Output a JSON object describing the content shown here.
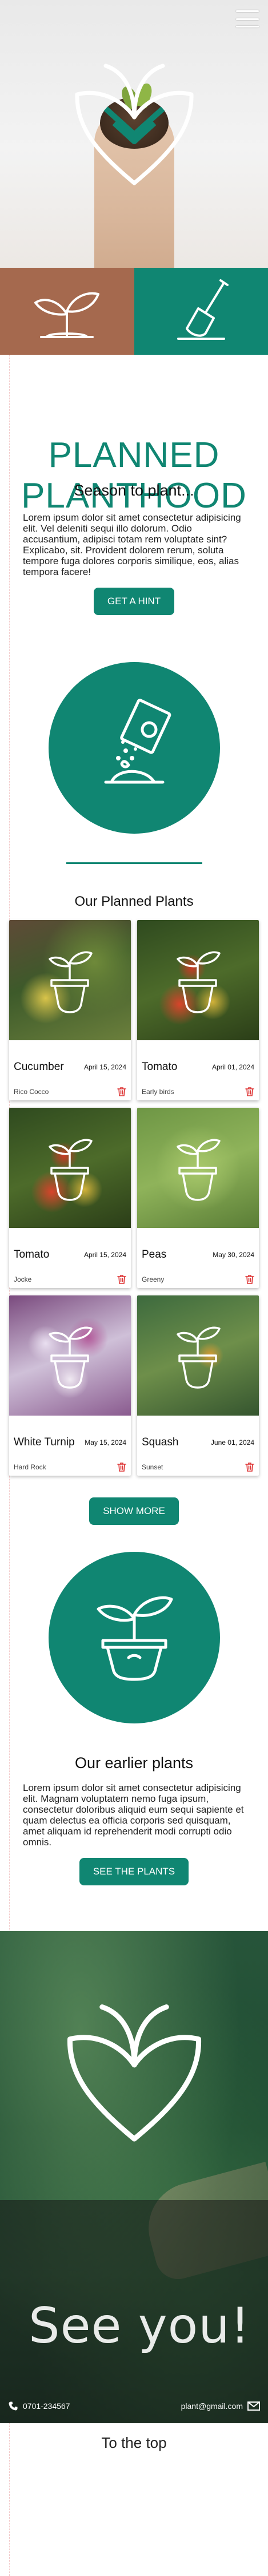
{
  "nav": {
    "menu_icon": "hamburger-menu-icon"
  },
  "hero": {
    "logo_icon": "leaf-heart-logo-icon"
  },
  "tiles": [
    {
      "icon": "sprout-icon",
      "color": "#a5694e"
    },
    {
      "icon": "shovel-icon",
      "color": "#108672"
    }
  ],
  "brand": {
    "title": "PLANNED PLANTHOOD"
  },
  "season": {
    "heading": "Season to plant...",
    "body": "Lorem ipsum dolor sit amet consectetur adipisicing elit. Vel deleniti sequi illo dolorum. Odio accusantium, adipisci totam rem voluptate sint? Explicabo, sit. Provident dolorem rerum, soluta tempore fuga dolores corporis similique, eos, alias tempora facere!",
    "button": "GET A HINT",
    "icon": "seed-packet-icon"
  },
  "planned": {
    "heading": "Our Planned Plants",
    "cards": [
      {
        "name": "Cucumber",
        "date": "April 15, 2024",
        "author": "Rico Cocco",
        "photo": "cucumber-photo"
      },
      {
        "name": "Tomato",
        "date": "April 01, 2024",
        "author": "Early birds",
        "photo": "tomato-photo"
      },
      {
        "name": "Tomato",
        "date": "April 15, 2024",
        "author": "Jocke",
        "photo": "tomato-photo"
      },
      {
        "name": "Peas",
        "date": "May 30, 2024",
        "author": "Greeny",
        "photo": "peas-photo"
      },
      {
        "name": "White Turnip",
        "date": "May 15, 2024",
        "author": "Hard Rock",
        "photo": "turnip-photo"
      },
      {
        "name": "Squash",
        "date": "June 01, 2024",
        "author": "Sunset",
        "photo": "squash-photo"
      }
    ],
    "show_more": "SHOW MORE"
  },
  "earlier": {
    "heading": "Our earlier plants",
    "body": "Lorem ipsum dolor sit amet consectetur adipisicing elit. Magnam voluptatem nemo fuga ipsum, consectetur doloribus aliquid eum sequi sapiente et quam delectus ea officia corporis sed quisquam, amet aliquam id reprehenderit modi corrupti odio omnis.",
    "button": "SEE THE PLANTS",
    "icon": "potted-plant-icon"
  },
  "footer": {
    "see_you": "See you!",
    "phone": "0701-234567",
    "email": "plant@gmail.com",
    "to_top": "To the top"
  },
  "colors": {
    "accent": "#108672",
    "brown": "#a5694e",
    "trash": "#d33"
  }
}
